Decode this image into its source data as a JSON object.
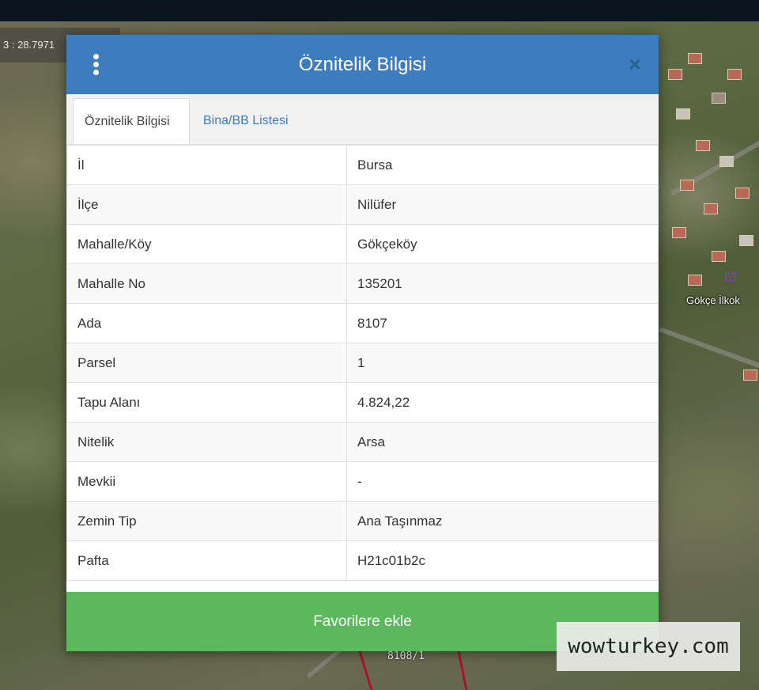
{
  "map": {
    "coord_readout": "3 : 28.7971",
    "place_label": "Gökçe İlkok",
    "parcel_label": "8108/1"
  },
  "dialog": {
    "title": "Öznitelik Bilgisi",
    "tabs": [
      {
        "label": "Öznitelik Bilgisi",
        "active": true
      },
      {
        "label": "Bina/BB Listesi",
        "active": false
      }
    ],
    "rows": [
      {
        "key": "İl",
        "value": "Bursa"
      },
      {
        "key": "İlçe",
        "value": "Nilüfer"
      },
      {
        "key": "Mahalle/Köy",
        "value": "Gökçeköy"
      },
      {
        "key": "Mahalle No",
        "value": "135201"
      },
      {
        "key": "Ada",
        "value": "8107"
      },
      {
        "key": "Parsel",
        "value": "1"
      },
      {
        "key": "Tapu Alanı",
        "value": "4.824,22"
      },
      {
        "key": "Nitelik",
        "value": "Arsa"
      },
      {
        "key": "Mevkii",
        "value": "-"
      },
      {
        "key": "Zemin Tip",
        "value": "Ana Taşınmaz"
      },
      {
        "key": "Pafta",
        "value": "H21c01b2c"
      }
    ],
    "favorite_button": "Favorilere ekle"
  },
  "watermark": "wowturkey.com",
  "colors": {
    "header": "#3d7cbd",
    "button": "#5cb85c",
    "tab_link": "#3d7cbd"
  },
  "icons": {
    "menu": "vertical-dots-menu-icon",
    "close": "close-icon",
    "place": "school-marker-icon"
  }
}
